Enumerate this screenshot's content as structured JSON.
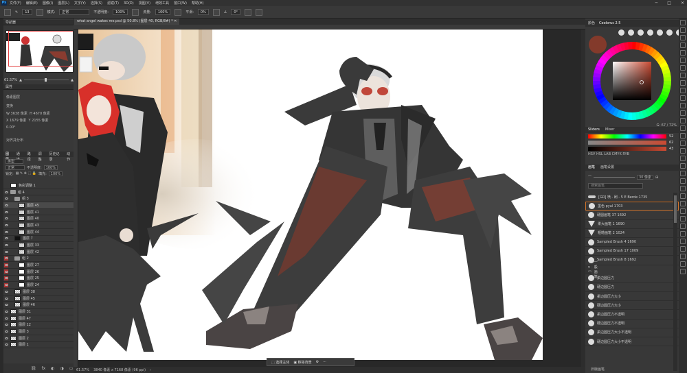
{
  "menubar": {
    "logo": "Ps",
    "items": [
      "文件(F)",
      "编辑(E)",
      "图像(I)",
      "图层(L)",
      "文字(Y)",
      "选择(S)",
      "滤镜(T)",
      "3D(D)",
      "视图(V)",
      "增效工具",
      "窗口(W)",
      "帮助(H)"
    ]
  },
  "options": {
    "size": "13",
    "mode_label": "模式:",
    "mode_value": "正常",
    "opacity_label": "不透明度:",
    "opacity_value": "100%",
    "flow_label": "流量:",
    "flow_value": "100%",
    "smooth_label": "平滑:",
    "smooth_value": "0%",
    "angle": "0°"
  },
  "document": {
    "tab": "what angel wakes me.psd @ 50.8% (图层 40, RGB/8#) *"
  },
  "navigator": {
    "title": "导航器",
    "zoom": "61.57%"
  },
  "properties": {
    "title": "属性",
    "kind": "像素图层",
    "section": "变换",
    "w_label": "W",
    "w": "3638 像素",
    "h_label": "H",
    "h": "4670 像素",
    "x_label": "X",
    "x": "1679 像素",
    "y_label": "Y",
    "y": "2155 像素",
    "angle": "0.00°",
    "align": "对齐并分布"
  },
  "layers_panel": {
    "tabs": [
      "图层",
      "通道",
      "路径",
      "调整",
      "历史记录",
      "动作"
    ],
    "kind_label": "类型",
    "blend": "正常",
    "opacity_label": "不透明度:",
    "opacity": "100%",
    "lock_label": "锁定:",
    "fill_label": "填充:",
    "fill": "100%",
    "layers": [
      {
        "name": "色彩调整 1",
        "thumb": "white",
        "eye": "",
        "indent": 0
      },
      {
        "name": "组 4",
        "thumb": "folder",
        "eye": "on",
        "indent": 0
      },
      {
        "name": "组 3",
        "thumb": "folder",
        "eye": "on",
        "indent": 1
      },
      {
        "name": "图层 45",
        "thumb": "checker",
        "eye": "on",
        "indent": 2,
        "sel": true
      },
      {
        "name": "图层 41",
        "thumb": "checker",
        "eye": "on",
        "indent": 2
      },
      {
        "name": "图层 40",
        "thumb": "checker",
        "eye": "on",
        "indent": 2
      },
      {
        "name": "图层 43",
        "thumb": "checker",
        "eye": "on",
        "indent": 2
      },
      {
        "name": "图层 44",
        "thumb": "checker",
        "eye": "on",
        "indent": 2
      },
      {
        "name": "图层 7",
        "thumb": "black",
        "eye": "on",
        "indent": 1
      },
      {
        "name": "图层 33",
        "thumb": "checker",
        "eye": "on",
        "indent": 2
      },
      {
        "name": "图层 42",
        "thumb": "checker",
        "eye": "on",
        "indent": 2
      },
      {
        "name": "组 2",
        "thumb": "folder",
        "eye": "red",
        "indent": 1
      },
      {
        "name": "图层 27",
        "thumb": "white",
        "eye": "red",
        "indent": 2
      },
      {
        "name": "图层 26",
        "thumb": "white",
        "eye": "red",
        "indent": 2
      },
      {
        "name": "图层 25",
        "thumb": "white",
        "eye": "red",
        "indent": 2
      },
      {
        "name": "图层 24",
        "thumb": "white",
        "eye": "red",
        "indent": 2
      },
      {
        "name": "图层 38",
        "thumb": "checker",
        "eye": "on",
        "indent": 1
      },
      {
        "name": "图层 45",
        "thumb": "checker",
        "eye": "on",
        "indent": 1
      },
      {
        "name": "图层 46",
        "thumb": "checker",
        "eye": "on",
        "indent": 1
      },
      {
        "name": "图层 31",
        "thumb": "checker",
        "eye": "on",
        "indent": 0
      },
      {
        "name": "图层 47",
        "thumb": "checker",
        "eye": "on",
        "indent": 0
      },
      {
        "name": "图层 12",
        "thumb": "checker",
        "eye": "on",
        "indent": 0
      },
      {
        "name": "图层 3",
        "thumb": "checker",
        "eye": "on",
        "indent": 0
      },
      {
        "name": "图层 2",
        "thumb": "checker",
        "eye": "on",
        "indent": 0
      },
      {
        "name": "图层 1",
        "thumb": "checker",
        "eye": "on",
        "indent": 0
      }
    ]
  },
  "status": {
    "zoom": "61.57%",
    "doc": "3840 像素 x 7168 像素 (96 ppi)"
  },
  "floatbar": {
    "select_subject": "选择主体",
    "remove_bg": "移除背景"
  },
  "color_panel": {
    "tabs": [
      "颜色",
      "Coolorus 2.5"
    ],
    "fg_color": "#833a2b",
    "gamut_label": "G: 67 / 72%",
    "slider_tabs": [
      "Sliders",
      "Mixer"
    ],
    "r": "52",
    "g": "62",
    "b": "43",
    "modes": "HSV  HSL  LAB  CMYK  RYB"
  },
  "brush_panel": {
    "tabs": [
      "画笔",
      "画笔设置"
    ],
    "size": "30 像素",
    "search": "搜索画笔",
    "brushes": [
      {
        "name": "[GR] 喷 - 刷 - 5 E Berde 1735",
        "kind": "stroke"
      },
      {
        "name": "墨色 pyal 1703",
        "kind": "round",
        "sel": true
      },
      {
        "name": "硬圆画笔 37 1692",
        "kind": "round"
      },
      {
        "name": "柔大画笔 1 1690",
        "kind": "tri"
      },
      {
        "name": "粗糙画笔 2 1024",
        "kind": "tri"
      },
      {
        "name": "Sampled Brush 4 1690",
        "kind": "round"
      },
      {
        "name": "Sampled Brush 17 1009",
        "kind": "round"
      },
      {
        "name": "Sampled Brush 8 1692",
        "kind": "round"
      },
      {
        "name": "一般画笔",
        "kind": "folder"
      },
      {
        "name": "柔边圆压力",
        "kind": "round"
      },
      {
        "name": "硬边圆压力",
        "kind": "round"
      },
      {
        "name": "柔边圆压力大小",
        "kind": "round"
      },
      {
        "name": "硬边圆压力大小",
        "kind": "round"
      },
      {
        "name": "柔边圆压力不透明",
        "kind": "round"
      },
      {
        "name": "硬边圆压力不透明",
        "kind": "round"
      },
      {
        "name": "柔边圆压力大小不透明",
        "kind": "round"
      },
      {
        "name": "硬边圆压力大小不透明",
        "kind": "round"
      }
    ],
    "footer": "旧版画笔"
  }
}
